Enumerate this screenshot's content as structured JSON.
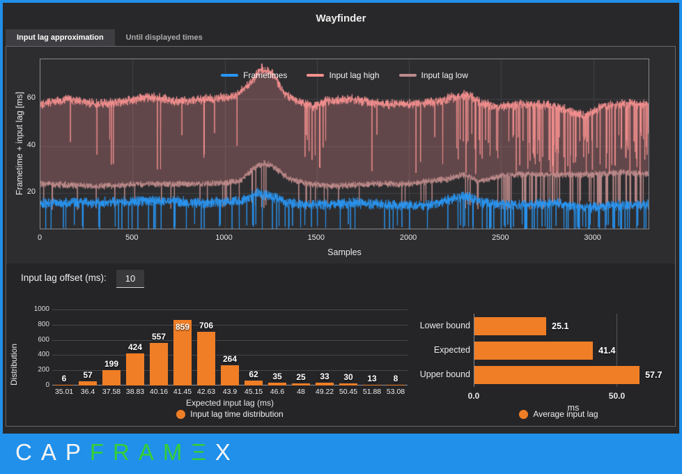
{
  "window": {
    "title": "Wayfinder"
  },
  "tabs": [
    {
      "label": "Input lag approximation",
      "active": true
    },
    {
      "label": "Until displayed times",
      "active": false
    }
  ],
  "offset_control": {
    "label": "Input lag offset (ms):",
    "value": "10"
  },
  "colors": {
    "accent_blue": "#2090EA",
    "orange": "#F07E26",
    "frametimes_blue": "#2996F3",
    "lag_high_salmon": "#F4908F",
    "lag_low_mauve": "#BF8B8B",
    "band_fill": "rgba(244,144,143,0.27)",
    "logo_green": "#34D034",
    "logo_white": "#F5F5F5"
  },
  "chart_data": [
    {
      "type": "line",
      "title": "",
      "xlabel": "Samples",
      "ylabel": "Frametime + input lag [ms]",
      "xlim": [
        0,
        3300
      ],
      "ylim": [
        5,
        77
      ],
      "xticks": [
        0,
        500,
        1000,
        1500,
        2000,
        2500,
        3000
      ],
      "yticks": [
        20,
        40,
        60
      ],
      "grid": true,
      "legend_position": "top-center",
      "n_points": 3300,
      "series": [
        {
          "name": "Frametimes",
          "color": "#2996F3",
          "keyframes": [
            [
              0,
              16
            ],
            [
              300,
              16
            ],
            [
              600,
              17
            ],
            [
              900,
              16
            ],
            [
              1100,
              17
            ],
            [
              1180,
              20
            ],
            [
              1250,
              19
            ],
            [
              1350,
              16
            ],
            [
              1500,
              15
            ],
            [
              1700,
              16
            ],
            [
              1900,
              15
            ],
            [
              2100,
              15
            ],
            [
              2250,
              18
            ],
            [
              2320,
              19
            ],
            [
              2400,
              16
            ],
            [
              2600,
              15
            ],
            [
              2800,
              16
            ],
            [
              2950,
              14
            ],
            [
              3100,
              15
            ],
            [
              3300,
              15
            ]
          ],
          "noise": 2.6,
          "spikes": {
            "to": [
              3,
              7
            ],
            "base_prob": 0.02,
            "regions": [
              [
                1150,
                1350,
                0.05
              ],
              [
                2300,
                3300,
                0.07
              ]
            ]
          }
        },
        {
          "name": "Input lag high",
          "color": "#F4908F",
          "keyframes": [
            [
              0,
              58
            ],
            [
              150,
              60
            ],
            [
              300,
              58
            ],
            [
              450,
              59
            ],
            [
              600,
              61
            ],
            [
              750,
              59
            ],
            [
              900,
              60
            ],
            [
              1050,
              61
            ],
            [
              1130,
              66
            ],
            [
              1200,
              73
            ],
            [
              1260,
              71
            ],
            [
              1320,
              63
            ],
            [
              1400,
              59
            ],
            [
              1480,
              57
            ],
            [
              1550,
              59
            ],
            [
              1700,
              60
            ],
            [
              1850,
              58
            ],
            [
              2000,
              58
            ],
            [
              2150,
              59
            ],
            [
              2250,
              61
            ],
            [
              2320,
              62
            ],
            [
              2400,
              58
            ],
            [
              2500,
              57
            ],
            [
              2650,
              58
            ],
            [
              2800,
              57
            ],
            [
              2900,
              54
            ],
            [
              2960,
              53
            ],
            [
              3050,
              57
            ],
            [
              3150,
              58
            ],
            [
              3300,
              58
            ]
          ],
          "noise": 2.3,
          "spikes": {
            "to": [
              28,
              46
            ],
            "base_prob": 0.012,
            "regions": [
              [
                1400,
                1550,
                0.09
              ],
              [
                2250,
                2500,
                0.09
              ],
              [
                2550,
                3300,
                0.11
              ]
            ]
          }
        },
        {
          "name": "Input lag low",
          "color": "#BF8B8B",
          "keyframes": [
            [
              0,
              24
            ],
            [
              300,
              23
            ],
            [
              600,
              24
            ],
            [
              900,
              24
            ],
            [
              1080,
              25
            ],
            [
              1150,
              30
            ],
            [
              1210,
              33
            ],
            [
              1270,
              31
            ],
            [
              1350,
              26
            ],
            [
              1450,
              24
            ],
            [
              1600,
              23
            ],
            [
              1800,
              24
            ],
            [
              2000,
              24
            ],
            [
              2200,
              26
            ],
            [
              2300,
              28
            ],
            [
              2380,
              25
            ],
            [
              2480,
              27
            ],
            [
              2600,
              28
            ],
            [
              2800,
              28
            ],
            [
              3000,
              28
            ],
            [
              3150,
              29
            ],
            [
              3300,
              28
            ]
          ],
          "noise": 1.6,
          "spikes": {
            "to": [
              13,
              17
            ],
            "base_prob": 0.015,
            "regions": [
              [
                2450,
                3300,
                0.09
              ]
            ]
          }
        }
      ],
      "fill_between": {
        "lower": "Input lag low",
        "upper": "Input lag high",
        "color": "rgba(244,144,143,0.27)"
      }
    },
    {
      "type": "bar",
      "categories": [
        "35.01",
        "36.4",
        "37.58",
        "38.83",
        "40.16",
        "41.45",
        "42.63",
        "43.9",
        "45.15",
        "46.6",
        "48",
        "49.22",
        "50.45",
        "51.88",
        "53.08"
      ],
      "values": [
        6,
        57,
        199,
        424,
        557,
        859,
        706,
        264,
        62,
        35,
        25,
        33,
        30,
        13,
        8
      ],
      "xlabel": "Expected input lag (ms)",
      "ylabel": "Distribution",
      "ylim": [
        0,
        1000
      ],
      "yticks": [
        0,
        200,
        400,
        600,
        800,
        1000
      ],
      "grid": true,
      "bar_color": "#F07E26",
      "legend": {
        "label": "Input lag time distribution",
        "marker_color": "#F07E26",
        "position": "bottom-center"
      }
    },
    {
      "type": "bar",
      "orientation": "horizontal",
      "categories": [
        "Lower bound",
        "Expected",
        "Upper bound"
      ],
      "values": [
        25.1,
        41.4,
        57.7
      ],
      "xlabel": "ms",
      "xlim": [
        0,
        69.6
      ],
      "xticks": [
        {
          "v": 0,
          "label": "0.0"
        },
        {
          "v": 50,
          "label": "50.0"
        }
      ],
      "bar_color": "#F07E26",
      "legend": {
        "label": "Average input lag",
        "marker_color": "#F07E26",
        "position": "bottom-center"
      }
    }
  ],
  "footer": {
    "logo_segments": [
      {
        "text": "CAP",
        "color": "#F5F5F5"
      },
      {
        "text": "FRAMΞ",
        "color": "#34D034"
      },
      {
        "text": "X",
        "color": "#F5F5F5"
      }
    ]
  }
}
